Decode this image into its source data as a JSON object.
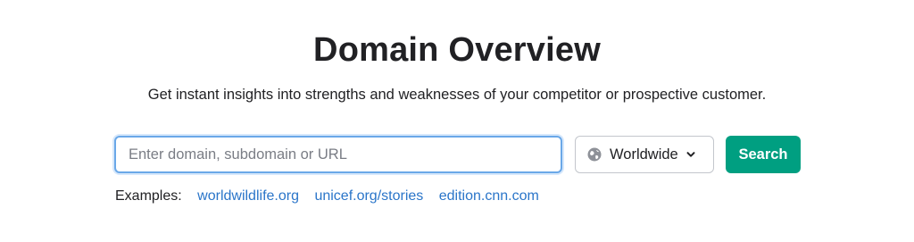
{
  "header": {
    "title": "Domain Overview",
    "subtitle": "Get instant insights into strengths and weaknesses of your competitor or prospective customer."
  },
  "search": {
    "value": "",
    "placeholder": "Enter domain, subdomain or URL",
    "database": {
      "selected": "Worldwide",
      "icon": "globe-icon",
      "dropdown_icon": "chevron-down-icon"
    },
    "button_label": "Search"
  },
  "examples": {
    "label": "Examples:",
    "links": [
      "worldwildlife.org",
      "unicef.org/stories",
      "edition.cnn.com"
    ]
  },
  "colors": {
    "accent_button": "#009f81",
    "link": "#2a75c9",
    "input_focus_border": "#6aa8e8",
    "text": "#212124"
  }
}
